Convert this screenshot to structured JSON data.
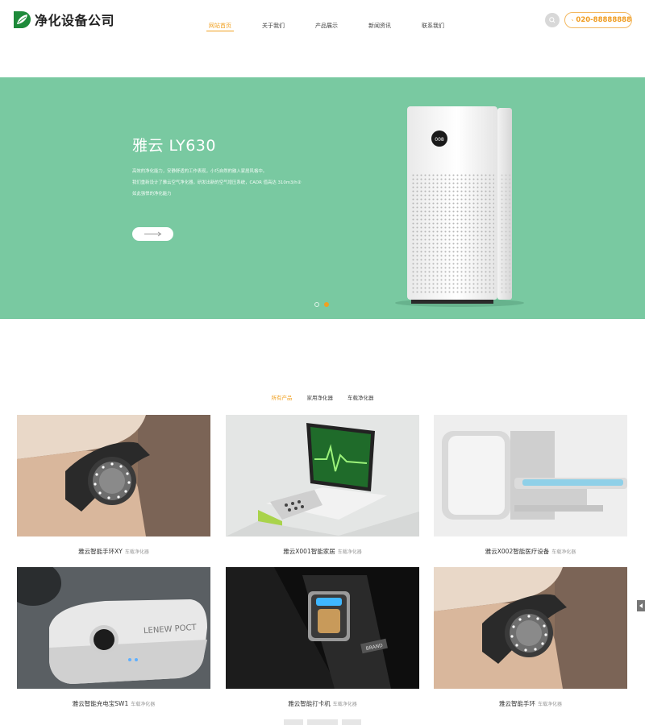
{
  "header": {
    "logo_text": "净化设备公司",
    "nav": [
      "网站首页",
      "关于我们",
      "产品展示",
      "新闻资讯",
      "联系我们"
    ],
    "active_nav": 0,
    "phone": "020-88888888"
  },
  "banner": {
    "title": "雅云 LY630",
    "lines": [
      "高效的净化能力，安静舒适的工作表现，小巧自然的融入家居风格中。",
      "我们重新设计了雅云空气净化器，研发出新的空气增压系统，CADR 值高达 310m3/h②",
      "如此强悍的净化能力"
    ],
    "purifier_display": "008",
    "active_slide": 1
  },
  "tabs": {
    "items": [
      "所有产品",
      "家用净化器",
      "车载净化器"
    ],
    "active": 0
  },
  "products": [
    {
      "name": "雅云智能手环XY",
      "category": "车载净化器",
      "image": "smart-band-wrist-image"
    },
    {
      "name": "雅云X001智能家居",
      "category": "车载净化器",
      "image": "ultrasound-console-image"
    },
    {
      "name": "雅云X002智能医疗设备",
      "category": "车载净化器",
      "image": "medical-scanner-image"
    },
    {
      "name": "雅云智能充电宝SW1",
      "category": "车载净化器",
      "image": "power-bank-image"
    },
    {
      "name": "雅云智能打卡机",
      "category": "车载净化器",
      "image": "fingerprint-scanner-image"
    },
    {
      "name": "雅云智能手环",
      "category": "车载净化器",
      "image": "smart-band-wrist-image"
    }
  ],
  "power_bank_label": "LENEW POCT",
  "fingerprint_label": "BRAND",
  "colors": {
    "accent": "#f0a020",
    "banner_bg": "#79c9a1"
  }
}
